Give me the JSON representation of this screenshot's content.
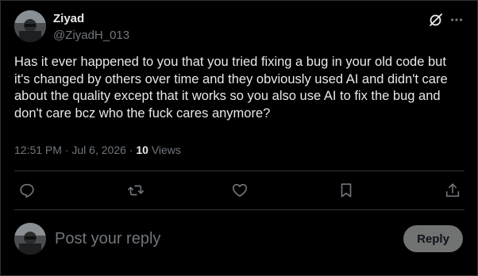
{
  "author": {
    "display_name": "Ziyad",
    "handle": "@ZiyadH_013"
  },
  "tweet": {
    "text": "Has it ever happened to you that you tried fixing a bug in your old code but it's changed by others over time and they obviously used AI and didn't care about the quality except that it works so you also use AI to fix the bug and don't care bcz who the fuck cares anymore?",
    "time": "12:51 PM",
    "separator": "·",
    "date": "Jul 6, 2026",
    "views_count": "10",
    "views_label": "Views"
  },
  "header_actions": {
    "grok_icon": "grok-icon",
    "more_icon": "more-horizontal-icon"
  },
  "actions": [
    {
      "icon": "reply-icon"
    },
    {
      "icon": "repost-icon"
    },
    {
      "icon": "like-heart-icon"
    },
    {
      "icon": "bookmark-icon"
    },
    {
      "icon": "share-icon"
    }
  ],
  "reply_box": {
    "placeholder": "Post your reply",
    "value": "",
    "button_label": "Reply"
  },
  "colors": {
    "background": "#000000",
    "text_primary": "#e7e9ea",
    "text_secondary": "#71767b",
    "divider": "#2f3336",
    "reply_button_bg": "#787a7a",
    "icon": "#71767b"
  }
}
